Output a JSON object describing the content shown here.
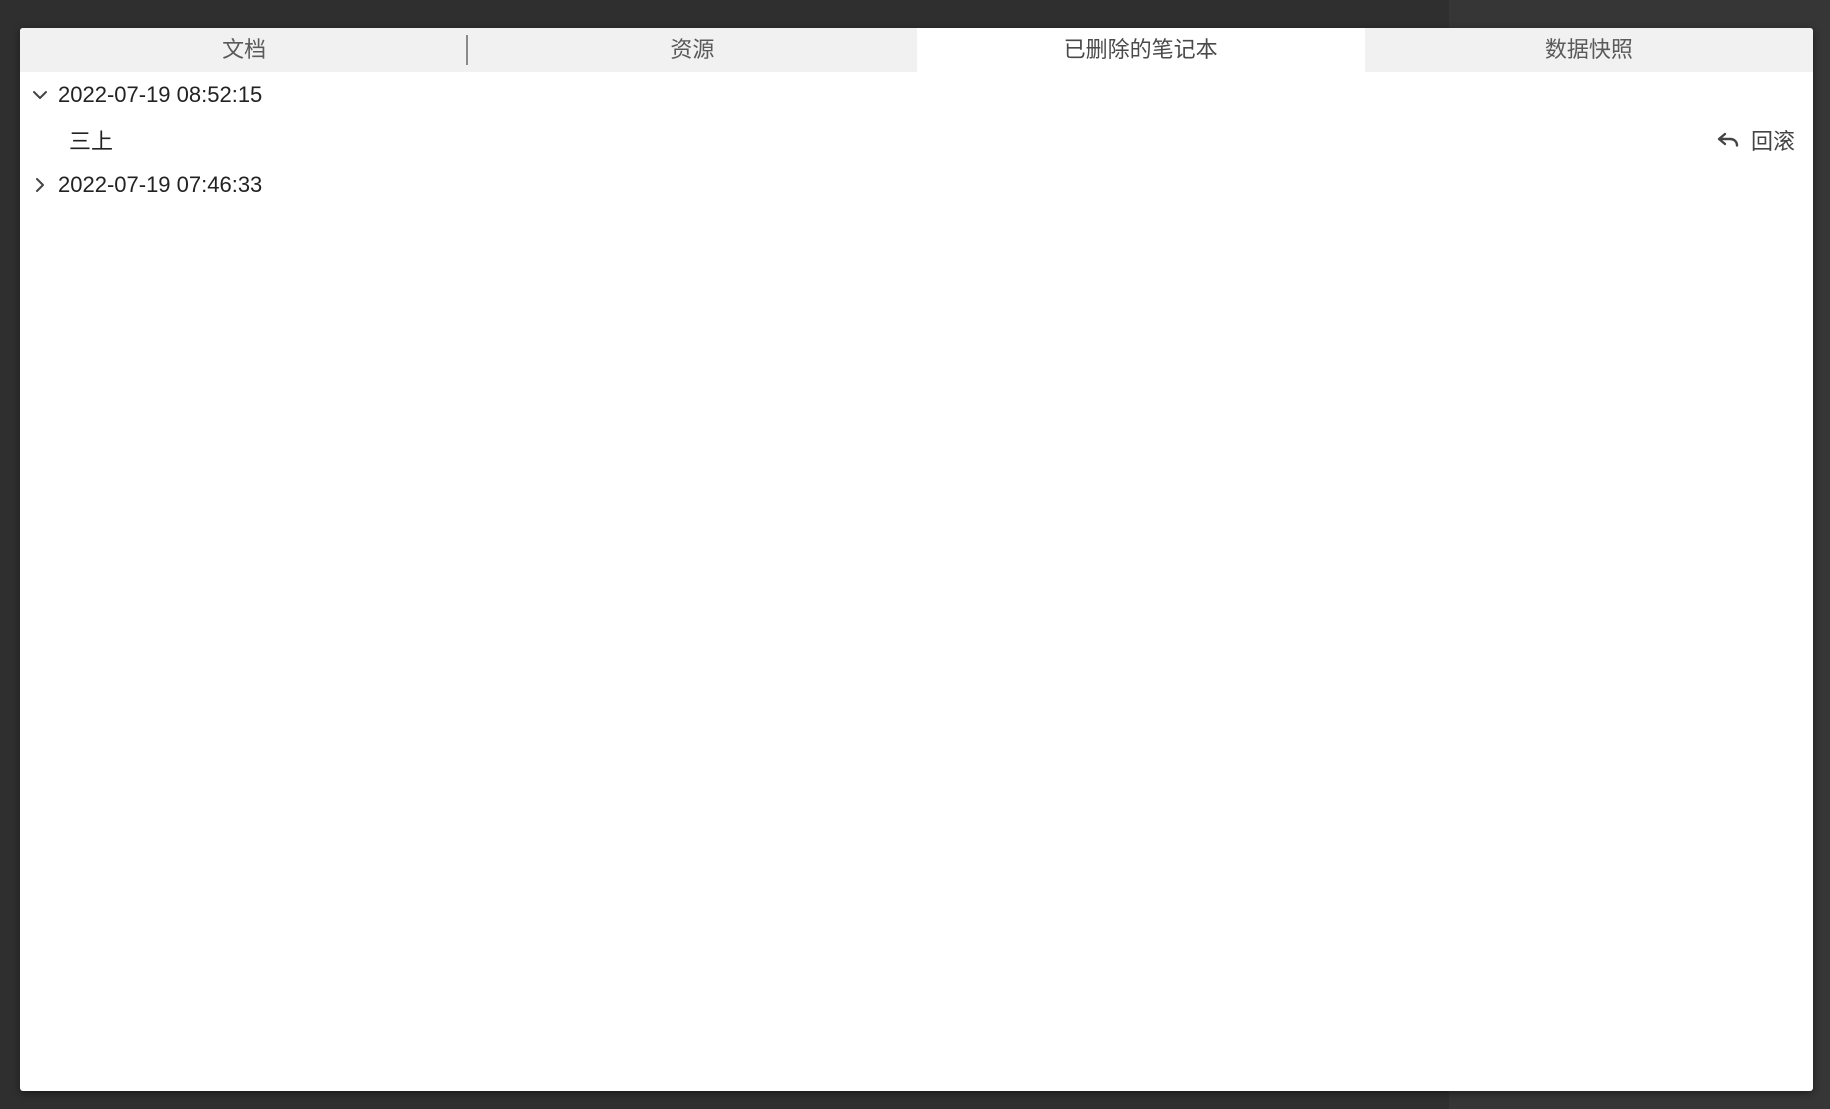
{
  "tabs": [
    {
      "label": "文档",
      "active": false
    },
    {
      "label": "资源",
      "active": false
    },
    {
      "label": "已删除的笔记本",
      "active": true
    },
    {
      "label": "数据快照",
      "active": false
    }
  ],
  "snapshots": [
    {
      "timestamp": "2022-07-19 08:52:15",
      "expanded": true,
      "items": [
        {
          "name": "三上",
          "action_label": "回滚",
          "action_icon": "undo-icon"
        }
      ]
    },
    {
      "timestamp": "2022-07-19 07:46:33",
      "expanded": false,
      "items": []
    }
  ],
  "colors": {
    "backdrop": "#2f2f2f",
    "tabbar": "#f1f1f1",
    "active_tab": "#ffffff",
    "text": "#222222"
  }
}
